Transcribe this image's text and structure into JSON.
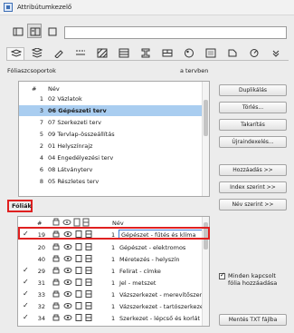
{
  "window": {
    "title": "Attribútumkezelő"
  },
  "search": {
    "value": ""
  },
  "groups_section": {
    "label": "Fóliaszcsoportok",
    "context_label": "a tervben",
    "column_number": "#",
    "column_name": "Név",
    "rows": [
      {
        "num": "1",
        "name": "02 Vázlatok",
        "selected": false
      },
      {
        "num": "3",
        "name": "06 Gépészeti terv",
        "selected": true
      },
      {
        "num": "7",
        "name": "07 Szerkezeti terv",
        "selected": false
      },
      {
        "num": "5",
        "name": "09 Tervlap-összeállítás",
        "selected": false
      },
      {
        "num": "2",
        "name": "01 Helyszínrajz",
        "selected": false
      },
      {
        "num": "4",
        "name": "04 Engedélyezési terv",
        "selected": false
      },
      {
        "num": "6",
        "name": "08 Látványterv",
        "selected": false
      },
      {
        "num": "8",
        "name": "05 Részletes terv",
        "selected": false
      }
    ]
  },
  "buttons": {
    "duplicate": "Duplikálás",
    "delete": "Törlés...",
    "purge": "Takarítás",
    "renumber": "Újraindexelés...",
    "append": "Hozzáadás >>",
    "overwrite_by_index": "Index szerint >>",
    "overwrite_by_name": "Név szerint >>",
    "save_txt": "Mentés TXT fájlba"
  },
  "option_checkbox": {
    "label_line1": "Minden kapcsolt",
    "label_line2": "fólia hozzáadása",
    "checked": true
  },
  "layers_section": {
    "label": "Fóliák",
    "column_number": "#",
    "column_name": "Név",
    "rows": [
      {
        "checked": true,
        "num": "19",
        "pen": "1",
        "name": "Gépészet - fűtés és klíma",
        "selected": true
      },
      {
        "checked": false,
        "num": "20",
        "pen": "1",
        "name": "Gépészet - elektromos",
        "selected": false
      },
      {
        "checked": false,
        "num": "40",
        "pen": "1",
        "name": "Méretezés - helyszín",
        "selected": false
      },
      {
        "checked": true,
        "num": "29",
        "pen": "1",
        "name": "Felirat - címke",
        "selected": false
      },
      {
        "checked": true,
        "num": "31",
        "pen": "1",
        "name": "Jel - metszet",
        "selected": false
      },
      {
        "checked": true,
        "num": "33",
        "pen": "1",
        "name": "Vázszerkezet - merevítőszerkezet",
        "selected": false
      },
      {
        "checked": true,
        "num": "32",
        "pen": "1",
        "name": "Vázszerkezet - tartószerkezet",
        "selected": false
      },
      {
        "checked": true,
        "num": "34",
        "pen": "1",
        "name": "Szerkezet - lépcső és korlát",
        "selected": false
      }
    ]
  },
  "colors": {
    "selection": "#a9cdf0",
    "highlight": "#e02020",
    "edit_border": "#3b7bd6"
  }
}
